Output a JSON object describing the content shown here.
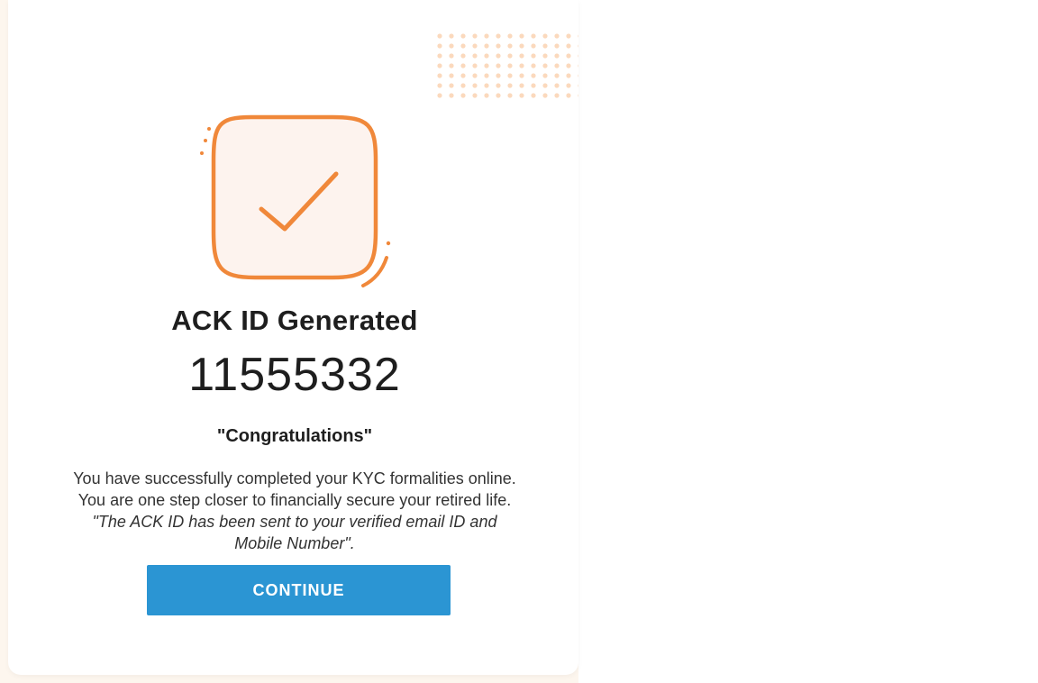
{
  "result": {
    "title": "ACK ID Generated",
    "ack_id": "11555332",
    "congrats": "\"Congratulations\"",
    "message_line1": "You have successfully completed your KYC formalities online.",
    "message_line2": "You are one step closer to financially secure your retired life.",
    "note": "\"The ACK ID has been sent to your verified email ID and Mobile Number\"."
  },
  "actions": {
    "continue_label": "CONTINUE"
  },
  "icons": {
    "success": "checkmark-icon",
    "decoration": "dot-pattern"
  },
  "colors": {
    "accent": "#f0883a",
    "accent_fill": "#fdf3ee",
    "button": "#2b95d3",
    "background": "#fdf6ee"
  }
}
